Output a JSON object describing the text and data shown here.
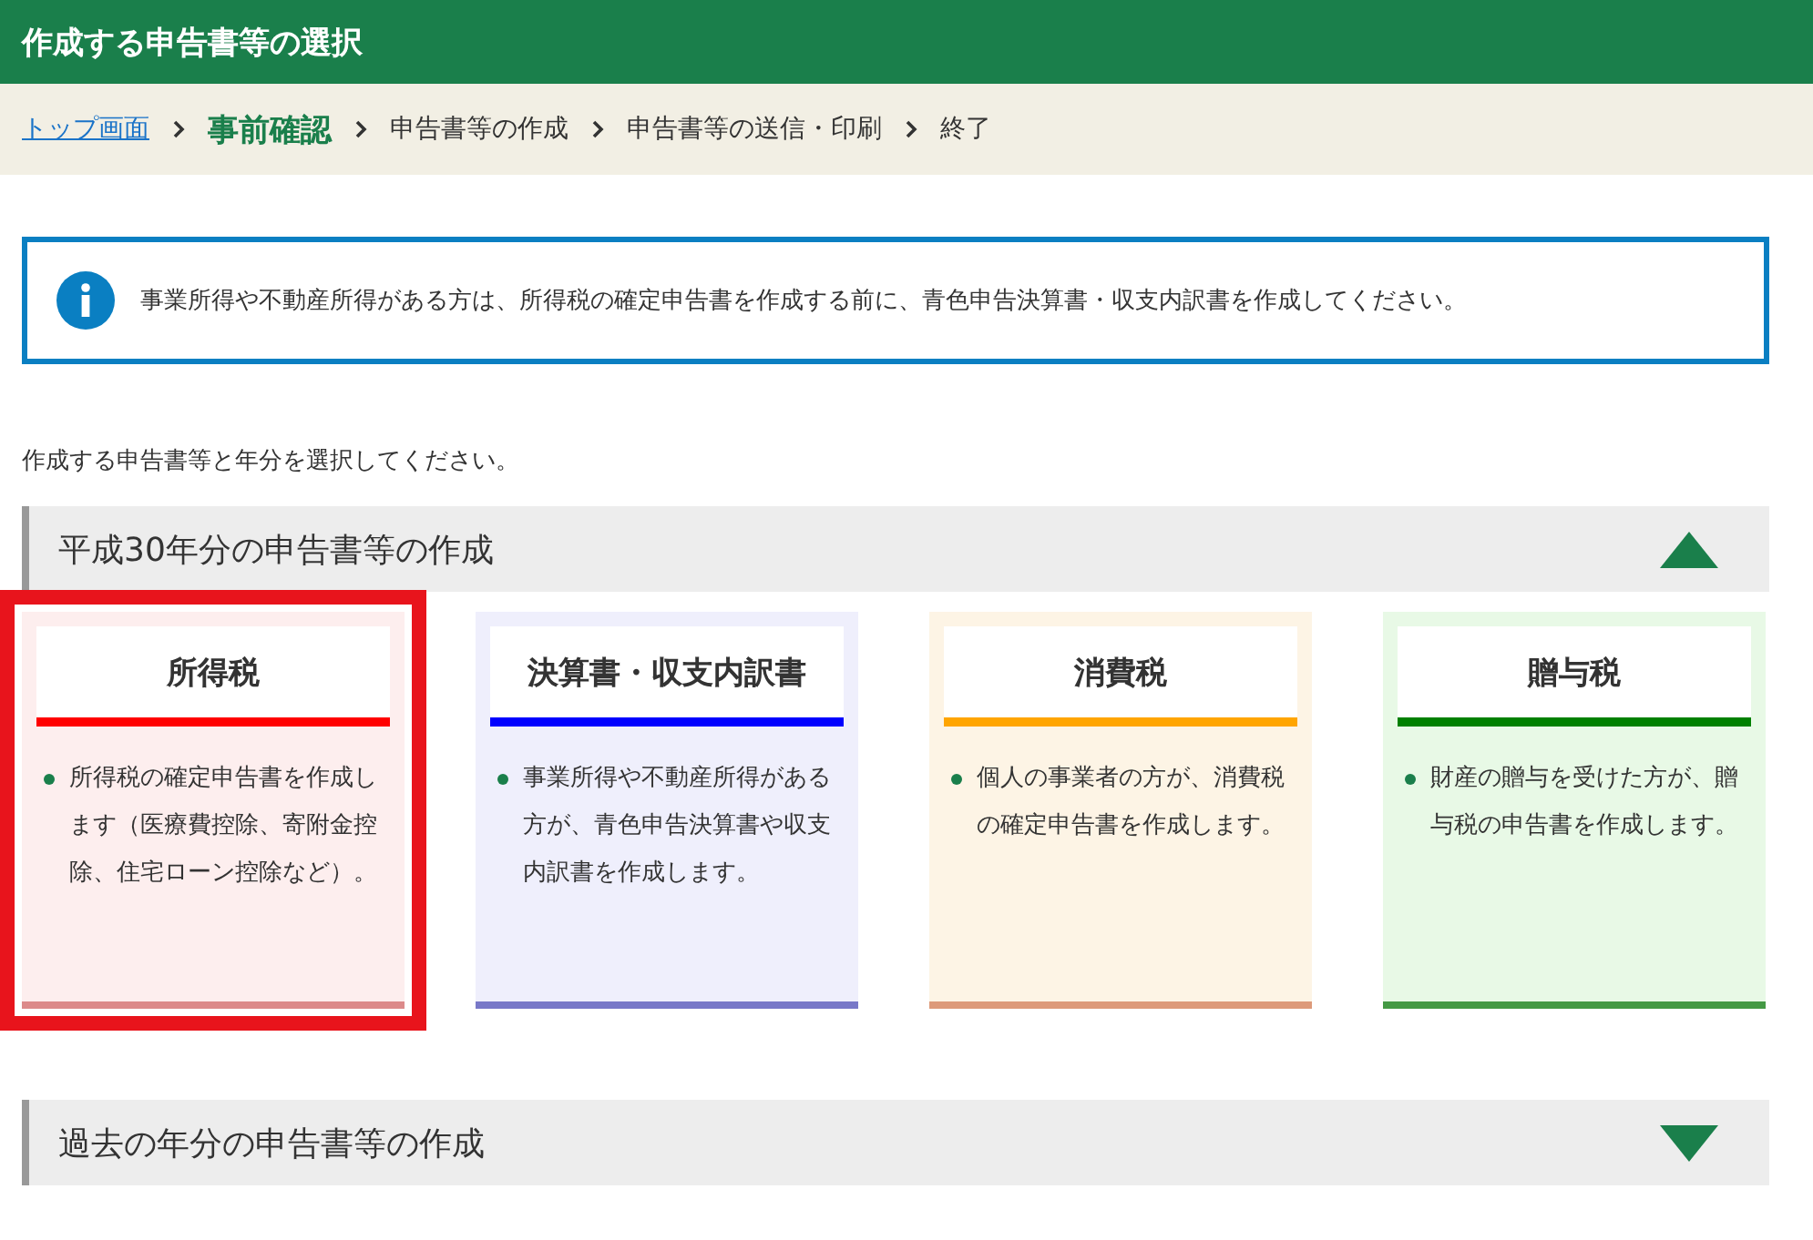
{
  "header": {
    "title": "作成する申告書等の選択"
  },
  "breadcrumb": [
    {
      "label": "トップ画面",
      "kind": "link"
    },
    {
      "label": "事前確認",
      "kind": "current"
    },
    {
      "label": "申告書等の作成",
      "kind": "step"
    },
    {
      "label": "申告書等の送信・印刷",
      "kind": "step"
    },
    {
      "label": "終了",
      "kind": "step"
    }
  ],
  "info": {
    "text": "事業所得や不動産所得がある方は、所得税の確定申告書を作成する前に、青色申告決算書・収支内訳書を作成してください。"
  },
  "instruction": "作成する申告書等と年分を選択してください。",
  "sections": [
    {
      "title": "平成30年分の申告書等の作成",
      "expanded": true,
      "cards": [
        {
          "title": "所得税",
          "text": "所得税の確定申告書を作成します（医療費控除、寄附金控除、住宅ローン控除など）。",
          "selected": true,
          "color": "#ff0000"
        },
        {
          "title": "決算書・収支内訳書",
          "text": "事業所得や不動産所得がある方が、青色申告決算書や収支内訳書を作成します。",
          "selected": false,
          "color": "#0000ff"
        },
        {
          "title": "消費税",
          "text": "個人の事業者の方が、消費税の確定申告書を作成します。",
          "selected": false,
          "color": "#ffa500"
        },
        {
          "title": "贈与税",
          "text": "財産の贈与を受けた方が、贈与税の申告書を作成します。",
          "selected": false,
          "color": "#008000"
        }
      ]
    },
    {
      "title": "過去の年分の申告書等の作成",
      "expanded": false
    }
  ]
}
